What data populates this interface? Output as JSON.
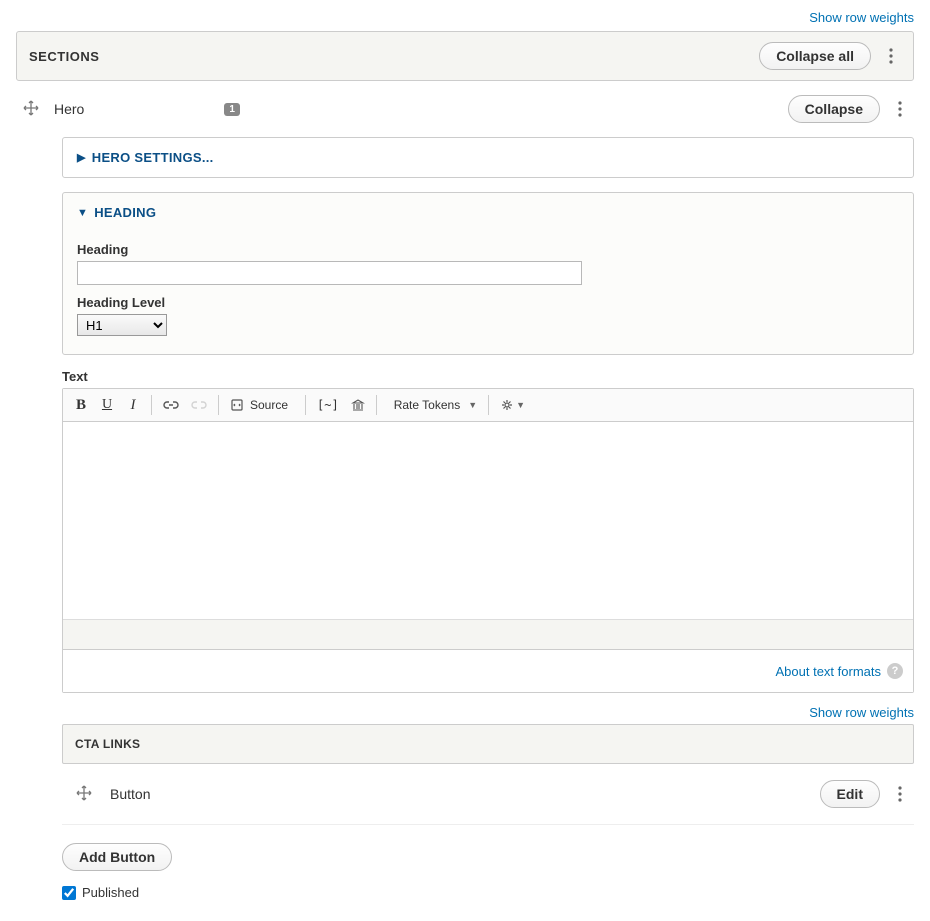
{
  "topLink": "Show row weights",
  "sections": {
    "title": "SECTIONS",
    "collapseAll": "Collapse all",
    "hero": {
      "label": "Hero",
      "badge": "1",
      "collapse": "Collapse",
      "heroSettings": "HERO SETTINGS...",
      "heading": {
        "title": "HEADING",
        "fieldLabel": "Heading",
        "value": "",
        "levelLabel": "Heading Level",
        "levelValue": "H1"
      },
      "textLabel": "Text",
      "toolbar": {
        "source": "Source",
        "rateTokens": "Rate Tokens"
      },
      "aboutFormats": "About text formats",
      "cta": {
        "rowWeights": "Show row weights",
        "title": "CTA LINKS",
        "buttonLabel": "Button",
        "edit": "Edit",
        "add": "Add Button"
      },
      "publishedLabel": "Published",
      "publishedChecked": true
    }
  }
}
